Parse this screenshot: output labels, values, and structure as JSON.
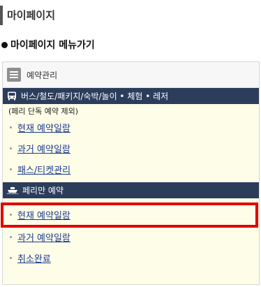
{
  "page": {
    "title": "마이페이지",
    "section_heading": "마이페이지 메뉴가기"
  },
  "menu": {
    "header_label": "예약관리",
    "groups": [
      {
        "label": "버스/철도/패키지/숙박/놀이 • 체험 • 레저",
        "icon": "bus-icon",
        "note": "(페리 단독 예약 제외)",
        "items": [
          {
            "label": "현재 예약일람"
          },
          {
            "label": "과거 예약일람"
          },
          {
            "label": "패스/티켓관리"
          }
        ]
      },
      {
        "label": "페리만 예약",
        "icon": "ferry-icon",
        "items": [
          {
            "label": "현재 예약일람",
            "highlighted": true
          },
          {
            "label": "과거 예약일람"
          },
          {
            "label": "취소완료"
          }
        ]
      }
    ]
  },
  "colors": {
    "category_bar": "#2c3d5c",
    "menu_background": "#fefde7",
    "link": "#1a3a8f",
    "highlight_border": "#e00000"
  }
}
